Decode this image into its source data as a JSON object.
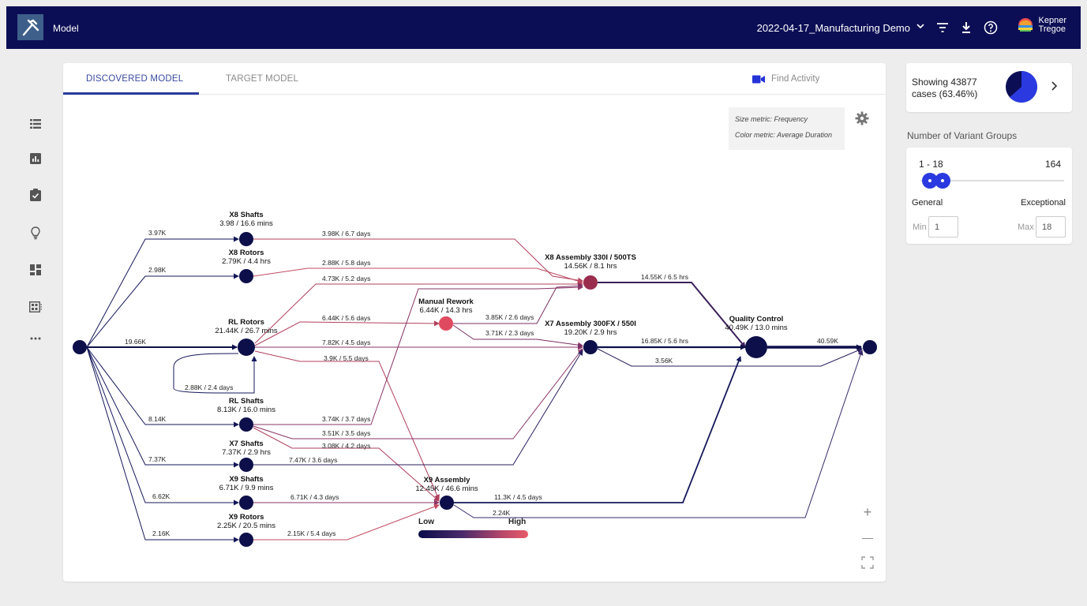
{
  "header": {
    "app_title": "Model",
    "dataset": "2022-04-17_Manufacturing Demo",
    "brand_line1": "Kepner",
    "brand_line2": "Tregoe"
  },
  "tabs": {
    "discovered": "DISCOVERED MODEL",
    "target": "TARGET MODEL",
    "find": "Find Activity"
  },
  "metrics": {
    "size": "Size metric: Frequency",
    "color": "Color metric: Average Duration"
  },
  "legend": {
    "low": "Low",
    "high": "High"
  },
  "zoom": {
    "in": "+",
    "out": "—"
  },
  "showing": {
    "line1": "Showing 43877",
    "line2": "cases (63.46%)",
    "fraction": 0.6346
  },
  "variants": {
    "title": "Number of Variant Groups",
    "range": "1 - 18",
    "max": "164",
    "general": "General",
    "exceptional": "Exceptional",
    "min_label": "Min",
    "min_value": "1",
    "max_label": "Max",
    "max_value": "18"
  },
  "process_map": {
    "nodes": [
      {
        "id": "start",
        "name": "",
        "stats": "",
        "color": "#0d0f4a"
      },
      {
        "id": "x8s",
        "name": "X8 Shafts",
        "stats": "3.98 / 16.6 mins",
        "color": "#0d0f4a"
      },
      {
        "id": "x8r",
        "name": "X8 Rotors",
        "stats": "2.79K / 4.4 hrs",
        "color": "#0d0f4a"
      },
      {
        "id": "rlr",
        "name": "RL Rotors",
        "stats": "21.44K / 26.7 mins",
        "color": "#0d0f4a"
      },
      {
        "id": "rls",
        "name": "RL Shafts",
        "stats": "8.13K / 16.0 mins",
        "color": "#0d0f4a"
      },
      {
        "id": "x7s",
        "name": "X7 Shafts",
        "stats": "7.37K / 2.9 hrs",
        "color": "#0d0f4a"
      },
      {
        "id": "x9s",
        "name": "X9 Shafts",
        "stats": "6.71K / 9.9 mins",
        "color": "#0d0f4a"
      },
      {
        "id": "x9r",
        "name": "X9 Rotors",
        "stats": "2.25K / 20.5 mins",
        "color": "#0d0f4a"
      },
      {
        "id": "mr",
        "name": "Manual Rework",
        "stats": "6.44K / 14.3 hrs",
        "color": "#e04a60"
      },
      {
        "id": "x8a",
        "name": "X8 Assembly 330I / 500TS",
        "stats": "14.56K / 8.1 hrs",
        "color": "#9a2d4e"
      },
      {
        "id": "x7a",
        "name": "X7 Assembly 300FX / 550I",
        "stats": "19.20K / 2.9 hrs",
        "color": "#0d0f4a"
      },
      {
        "id": "x9a",
        "name": "X9 Assembly",
        "stats": "12.45K / 46.6 mins",
        "color": "#0d0f4a"
      },
      {
        "id": "qc",
        "name": "Quality Control",
        "stats": "40.49K / 13.0 mins",
        "color": "#0d0f4a"
      },
      {
        "id": "end",
        "name": "",
        "stats": "",
        "color": "#0d0f4a"
      }
    ],
    "edges": [
      {
        "from": "start",
        "to": "x8s",
        "label": "3.97K",
        "color": "#15185a"
      },
      {
        "from": "start",
        "to": "x8r",
        "label": "2.98K",
        "color": "#15185a"
      },
      {
        "from": "start",
        "to": "rlr",
        "label": "19.66K",
        "color": "#0d0f4a"
      },
      {
        "from": "start",
        "to": "rls",
        "label": "8.14K",
        "color": "#15185a"
      },
      {
        "from": "start",
        "to": "x7s",
        "label": "7.37K",
        "color": "#15185a"
      },
      {
        "from": "start",
        "to": "x9s",
        "label": "6.62K",
        "color": "#15185a"
      },
      {
        "from": "start",
        "to": "x9r",
        "label": "2.16K",
        "color": "#15185a"
      },
      {
        "from": "rlr",
        "to": "rlr",
        "label": "2.88K / 2.4 days",
        "color": "#15185a"
      },
      {
        "from": "x8s",
        "to": "x8a",
        "label": "3.98K / 6.7 days",
        "color": "#b0405e"
      },
      {
        "from": "x8r",
        "to": "x8a",
        "label": "2.88K / 5.8 days",
        "color": "#c24a62"
      },
      {
        "from": "rlr",
        "to": "x8a",
        "label": "4.73K / 5.2 days",
        "color": "#b0405e"
      },
      {
        "from": "rlr",
        "to": "mr",
        "label": "6.44K / 5.6 days",
        "color": "#b0405e"
      },
      {
        "from": "rlr",
        "to": "x7a",
        "label": "7.82K / 4.5 days",
        "color": "#8a3466"
      },
      {
        "from": "rlr",
        "to": "x9a",
        "label": "3.9K / 5.5 days",
        "color": "#b0405e"
      },
      {
        "from": "mr",
        "to": "x8a",
        "label": "3.85K / 2.6 days",
        "color": "#7a2f62"
      },
      {
        "from": "mr",
        "to": "x7a",
        "label": "3.71K / 2.3 days",
        "color": "#7a2f62"
      },
      {
        "from": "rls",
        "to": "mr",
        "label": "3.74K / 3.7 days",
        "color": "#8a3466"
      },
      {
        "from": "rls",
        "to": "x7a",
        "label": "3.51K / 3.5 days",
        "color": "#8a3466"
      },
      {
        "from": "rls",
        "to": "x9a",
        "label": "3.08K / 4.2 days",
        "color": "#b0405e"
      },
      {
        "from": "x7s",
        "to": "x7a",
        "label": "7.47K / 3.6 days",
        "color": "#2a1f62"
      },
      {
        "from": "x9s",
        "to": "x9a",
        "label": "6.71K / 4.3 days",
        "color": "#8a3466"
      },
      {
        "from": "x9r",
        "to": "x9a",
        "label": "2.15K / 5.4 days",
        "color": "#c24a62"
      },
      {
        "from": "x8a",
        "to": "qc",
        "label": "14.55K / 6.5 hrs",
        "color": "#3a1f5a"
      },
      {
        "from": "x7a",
        "to": "qc",
        "label": "16.85K / 5.6 hrs",
        "color": "#0d0f4a"
      },
      {
        "from": "x7a",
        "to": "end",
        "label": "3.56K",
        "color": "#2a1f62"
      },
      {
        "from": "x9a",
        "to": "qc",
        "label": "11.3K / 4.5 days",
        "color": "#15185a"
      },
      {
        "from": "x9a",
        "to": "end",
        "label": "2.24K",
        "color": "#3a2a6a"
      },
      {
        "from": "qc",
        "to": "end",
        "label": "40.59K",
        "color": "#0d0f4a"
      }
    ]
  }
}
